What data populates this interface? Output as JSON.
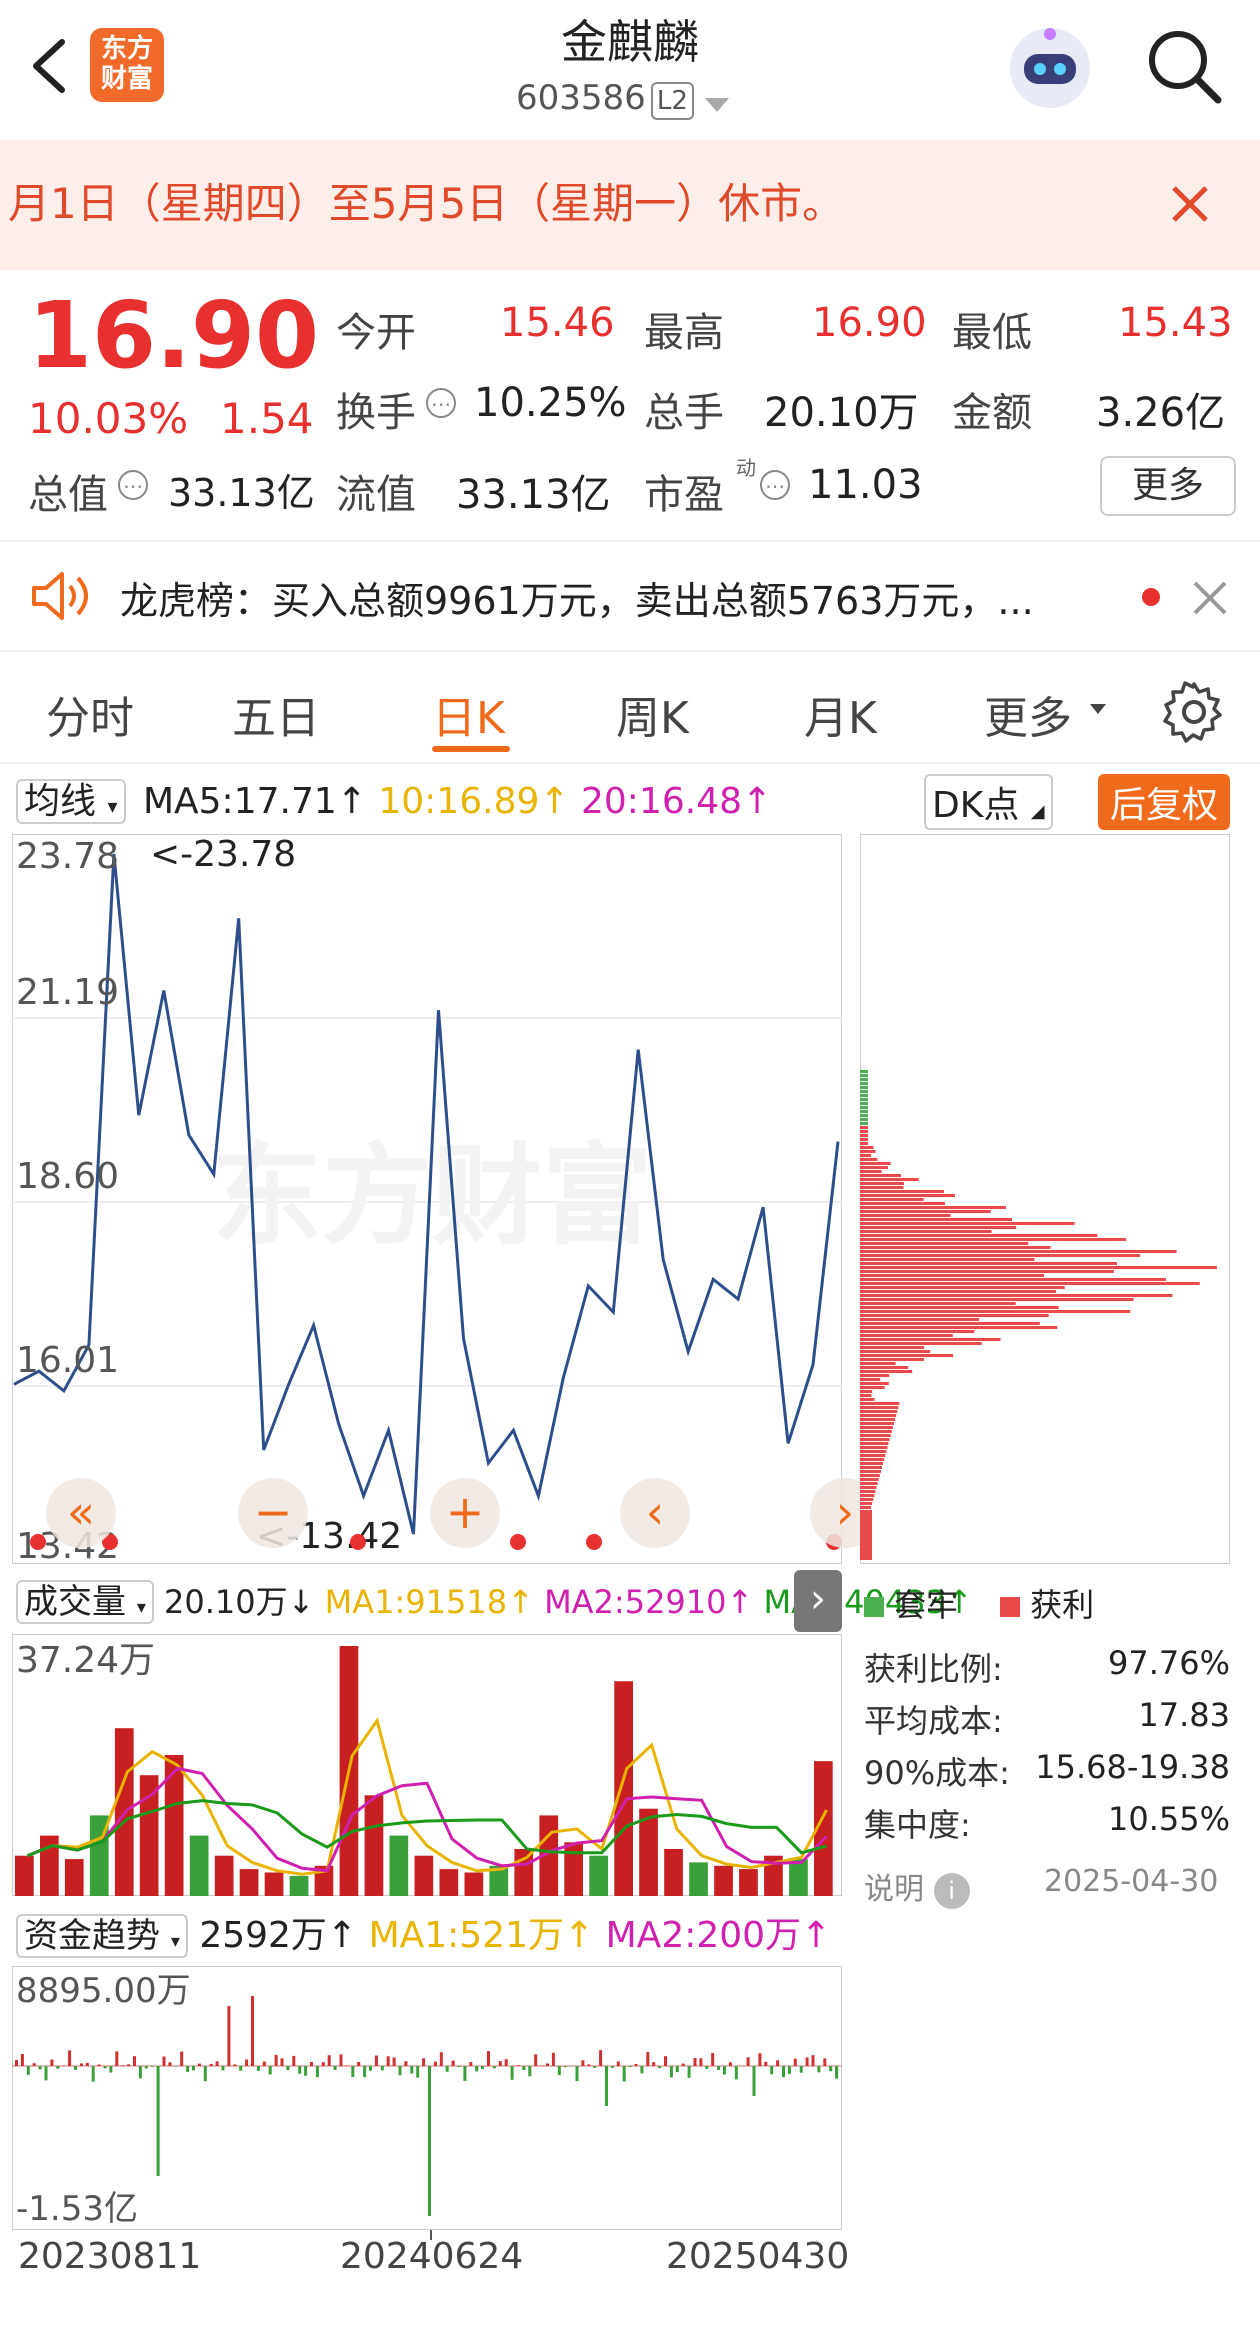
{
  "header": {
    "title": "金麒麟",
    "code": "603586",
    "level_badge": "L2",
    "logo_text": "东方\n财富"
  },
  "banner": {
    "text": "月1日（星期四）至5月5日（星期一）休市。"
  },
  "quote": {
    "price": "16.90",
    "change_pct": "10.03%",
    "change": "1.54",
    "open_label": "今开",
    "open": "15.46",
    "high_label": "最高",
    "high": "16.90",
    "low_label": "最低",
    "low": "15.43",
    "turnover_label": "换手",
    "turnover": "10.25%",
    "volume_label": "总手",
    "volume": "20.10万",
    "amount_label": "金额",
    "amount": "3.26亿",
    "mktcap_label": "总值",
    "mktcap": "33.13亿",
    "float_label": "流值",
    "float": "33.13亿",
    "pe_label": "市盈",
    "pe_sup": "动",
    "pe": "11.03",
    "more_label": "更多"
  },
  "news": {
    "text": "龙虎榜：买入总额9961万元，卖出总额5763万元，..."
  },
  "tabs": [
    "分时",
    "五日",
    "日K",
    "周K",
    "月K",
    "更多"
  ],
  "active_tab": "日K",
  "ma_row": {
    "selector": "均线",
    "ma5": "MA5:17.71↑",
    "ma10": "10:16.89↑",
    "ma20": "20:16.48↑",
    "dk": "DK点",
    "adjust": "后复权"
  },
  "price_axis": {
    "labels": [
      "23.78",
      "21.19",
      "18.60",
      "16.01",
      "13.42"
    ],
    "max_note": "<-23.78",
    "min_note": "<-13.42"
  },
  "watermark": "东方财富",
  "volume_row": {
    "selector": "成交量",
    "value": "20.10万↓",
    "ma1": "MA1:91518↑",
    "ma2": "MA2:52910↑",
    "ma3": "MA3:40433↑",
    "axis_top": "37.24万"
  },
  "fund_row": {
    "selector": "资金趋势",
    "value": "2592万↑",
    "ma1": "MA1:521万↑",
    "ma2": "MA2:200万↑",
    "axis_top": "8895.00万",
    "axis_bottom": "-1.53亿"
  },
  "chip": {
    "legend_trapped": "套牢",
    "legend_profit": "获利",
    "stats": [
      {
        "label": "获利比例:",
        "value": "97.76%"
      },
      {
        "label": "平均成本:",
        "value": "17.83"
      },
      {
        "label": "90%成本:",
        "value": "15.68-19.38"
      },
      {
        "label": "集中度:",
        "value": "10.55%"
      }
    ],
    "note_label": "说明",
    "note_date": "2025-04-30"
  },
  "dates": [
    "20230811",
    "20240624",
    "20250430"
  ],
  "colors": {
    "accent": "#f06a1b",
    "up": "#e8302f",
    "down": "#2aa02a",
    "line": "#2c4f8c"
  },
  "chart_data": [
    {
      "type": "line",
      "title": "",
      "xlabel": "",
      "ylabel": "",
      "x": [
        "20230811",
        "20240624",
        "20250430"
      ],
      "ylim": [
        13.42,
        23.78
      ],
      "series": [
        {
          "values": [
            15.7,
            15.9,
            15.6,
            16.3,
            23.78,
            19.8,
            21.7,
            19.5,
            18.9,
            22.8,
            14.7,
            15.7,
            16.6,
            15.1,
            14.0,
            15.0,
            13.42,
            21.4,
            16.4,
            14.5,
            15.0,
            14.0,
            15.8,
            17.2,
            16.8,
            20.8,
            17.6,
            16.2,
            17.3,
            17.0,
            18.4,
            14.8,
            16.0,
            19.4
          ]
        }
      ]
    },
    {
      "type": "bar",
      "title": "",
      "ylim": [
        0,
        372400
      ],
      "series": [
        {
          "values": [
            60000,
            90000,
            55000,
            120000,
            250000,
            180000,
            210000,
            90000,
            60000,
            40000,
            35000,
            30000,
            45000,
            372400,
            150000,
            90000,
            60000,
            40000,
            35000,
            45000,
            70000,
            120000,
            80000,
            60000,
            320000,
            130000,
            70000,
            50000,
            45000,
            40000,
            60000,
            55000,
            201000
          ]
        }
      ]
    }
  ]
}
